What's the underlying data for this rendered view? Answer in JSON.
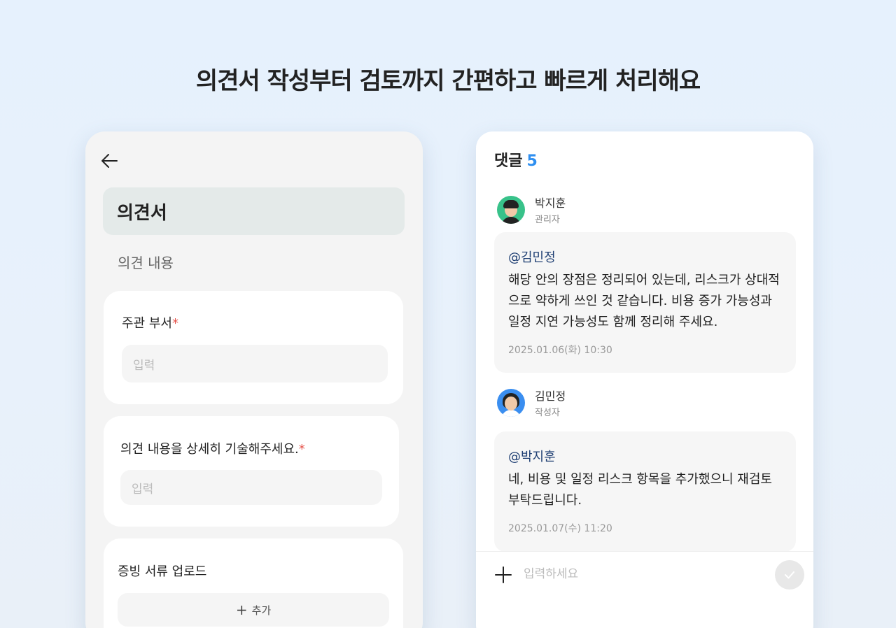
{
  "headline": "의견서 작성부터 검토까지 간편하고 빠르게 처리해요",
  "form": {
    "back_icon": "arrow-left-icon",
    "title": "의견서",
    "section_label": "의견 내용",
    "fields": [
      {
        "label": "주관 부서",
        "required_mark": "*",
        "placeholder": "입력"
      },
      {
        "label": "의견 내용을 상세히 기술해주세요.",
        "required_mark": "*",
        "placeholder": "입력"
      }
    ],
    "upload": {
      "label": "증빙 서류 업로드",
      "add_label": "추가",
      "add_icon": "plus-icon"
    }
  },
  "comments": {
    "title": "댓글",
    "count": "5",
    "items": [
      {
        "name": "박지훈",
        "role": "관리자",
        "mention": "@김민정",
        "text": "해당 안의 장점은 정리되어 있는데, 리스크가 상대적으로 약하게 쓰인 것 같습니다. 비용 증가 가능성과 일정 지연 가능성도 함께 정리해 주세요.",
        "time": "2025.01.06(화) 10:30"
      },
      {
        "name": "김민정",
        "role": "작성자",
        "mention": "@박지훈",
        "text": "네, 비용 및 일정 리스크 항목을 추가했으니 재검토 부탁드립니다.",
        "time": "2025.01.07(수) 11:20"
      }
    ],
    "input": {
      "placeholder": "입력하세요",
      "attach_icon": "plus-icon",
      "send_icon": "check-icon"
    }
  },
  "colors": {
    "accent": "#2f8ff0",
    "mention": "#1f3f73",
    "required": "#e5534b"
  }
}
